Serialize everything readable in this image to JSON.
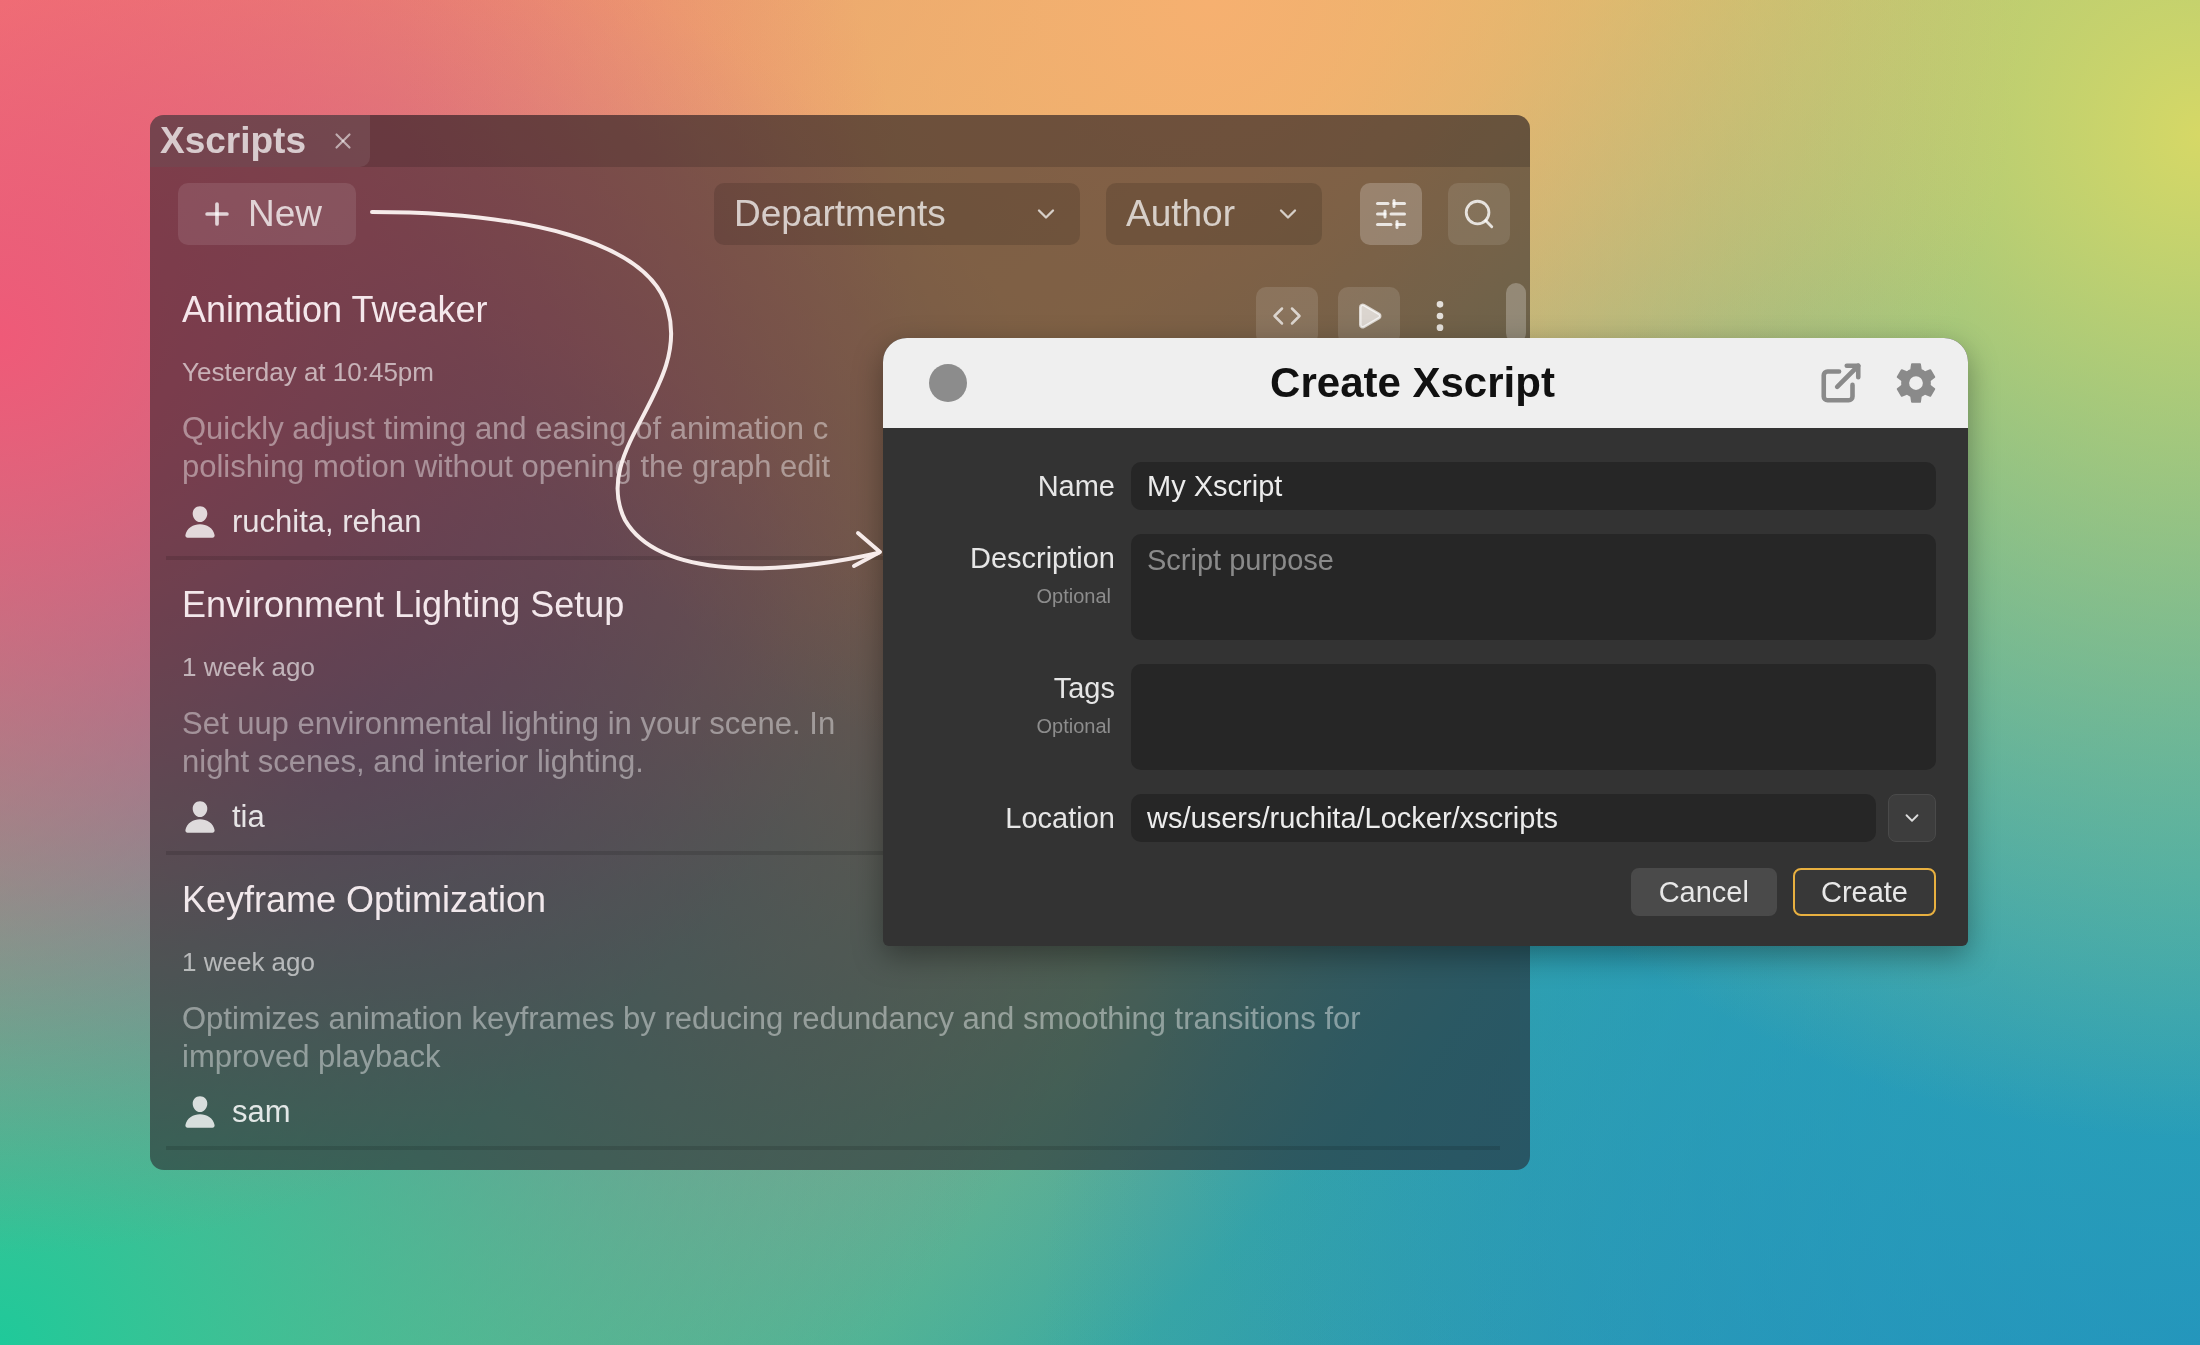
{
  "window": {
    "title": "Xscripts"
  },
  "toolbar": {
    "new_label": "New",
    "filters": [
      {
        "label": "Departments"
      },
      {
        "label": "Author"
      }
    ]
  },
  "scripts": [
    {
      "title": "Animation Tweaker",
      "updated": "Yesterday at 10:45pm",
      "description_lines": [
        "Quickly adjust timing and easing of animation c",
        "polishing motion without opening the graph edit"
      ],
      "authors": "ruchita, rehan",
      "actions_visible": true
    },
    {
      "title": "Environment Lighting Setup",
      "updated": "1 week ago",
      "description_lines": [
        "Set uup environmental lighting in your scene. In",
        "night scenes, and interior lighting."
      ],
      "authors": "tia",
      "actions_visible": false
    },
    {
      "title": "Keyframe Optimization",
      "updated": "1 week ago",
      "description_lines": [
        "Optimizes animation keyframes by reducing redundancy and smoothing transitions for",
        "improved playback"
      ],
      "authors": "sam",
      "actions_visible": false
    }
  ],
  "dialog": {
    "title": "Create Xscript",
    "fields": [
      {
        "kind": "text",
        "label": "Name",
        "value": "My Xscript"
      },
      {
        "kind": "textarea",
        "label": "Description",
        "hint": "Optional",
        "placeholder": "Script purpose"
      },
      {
        "kind": "textarea",
        "label": "Tags",
        "hint": "Optional"
      },
      {
        "kind": "select",
        "label": "Location",
        "value": "ws/users/ruchita/Locker/xscripts"
      }
    ],
    "buttons": [
      {
        "label": "Cancel",
        "primary": false
      },
      {
        "label": "Create",
        "primary": true
      }
    ]
  }
}
